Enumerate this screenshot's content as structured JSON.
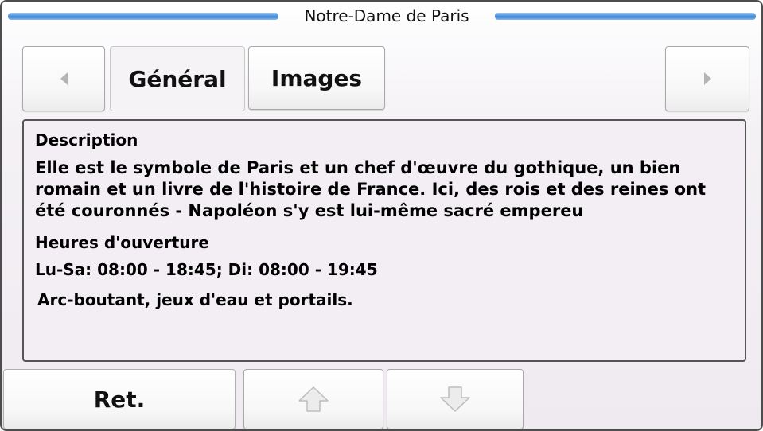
{
  "window": {
    "title": "Notre-Dame de Paris"
  },
  "tabs": [
    {
      "label": "Général",
      "selected": false
    },
    {
      "label": "Images",
      "selected": true
    }
  ],
  "content": {
    "description_heading": "Description",
    "description_text": "Elle est le symbole de Paris et un chef d'œuvre du gothique, un bien romain et un livre de l'histoire de France. Ici, des rois et des reines ont été couronnés - Napoléon s'y est lui-même sacré empereu",
    "hours_heading": "Heures d'ouverture",
    "hours_text": "Lu-Sa: 08:00 - 18:45; Di: 08:00 - 19:45",
    "extra_text": "Arc-boutant,  jeux d'eau et portails."
  },
  "footer": {
    "back_label": "Ret."
  },
  "icons": {
    "prev": "arrow-left-icon",
    "next": "arrow-right-icon",
    "scroll_up": "arrow-up-icon",
    "scroll_down": "arrow-down-icon"
  },
  "colors": {
    "title_line": "#4f93e0",
    "border": "#4d4d4d",
    "disabled_icon": "#b5b5b5"
  }
}
